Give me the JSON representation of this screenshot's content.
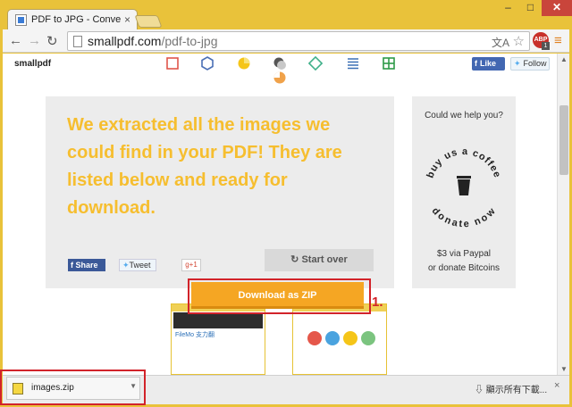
{
  "browser": {
    "tab_title": "PDF to JPG - Convert yo",
    "tab_close": "×",
    "url_host": "smallpdf.com",
    "url_path": "/pdf-to-jpg",
    "abp_label": "ABP",
    "abp_count": "1",
    "window": {
      "minimize": "–",
      "maximize": "□",
      "close": "✕"
    },
    "nav": {
      "back": "←",
      "forward": "→",
      "reload": "↻"
    },
    "menu": "≡",
    "star": "☆"
  },
  "header": {
    "logo": "smallpdf",
    "tool_icons": [
      "compress-icon",
      "hex-icon",
      "pie-icon",
      "merge-icon",
      "diamond-icon",
      "lines-icon",
      "grid-icon",
      "circle-icon"
    ],
    "fb_like": "Like",
    "tw_follow": "Follow"
  },
  "hero": {
    "message": "We extracted all the images we could find in your PDF! They are listed below and ready for download.",
    "share": "Share",
    "tweet": "Tweet",
    "gplus": "g+1",
    "start_over": "Start over"
  },
  "sidebar": {
    "question": "Could we help you?",
    "badge_top": "buy us a coffee",
    "badge_bottom": "donate now",
    "price": "$3 via Paypal",
    "bitcoin": "or donate Bitcoins"
  },
  "results": {
    "download_zip": "Download as ZIP",
    "step": "1.",
    "thumb1_text": "FileMo 支力翻"
  },
  "download_shelf": {
    "filename": "images.zip",
    "show_all": "顯示所有下載...",
    "close": "×"
  },
  "colors": {
    "accent": "#f6be2f",
    "zip_button": "#f5a623",
    "highlight": "#d2232a"
  }
}
